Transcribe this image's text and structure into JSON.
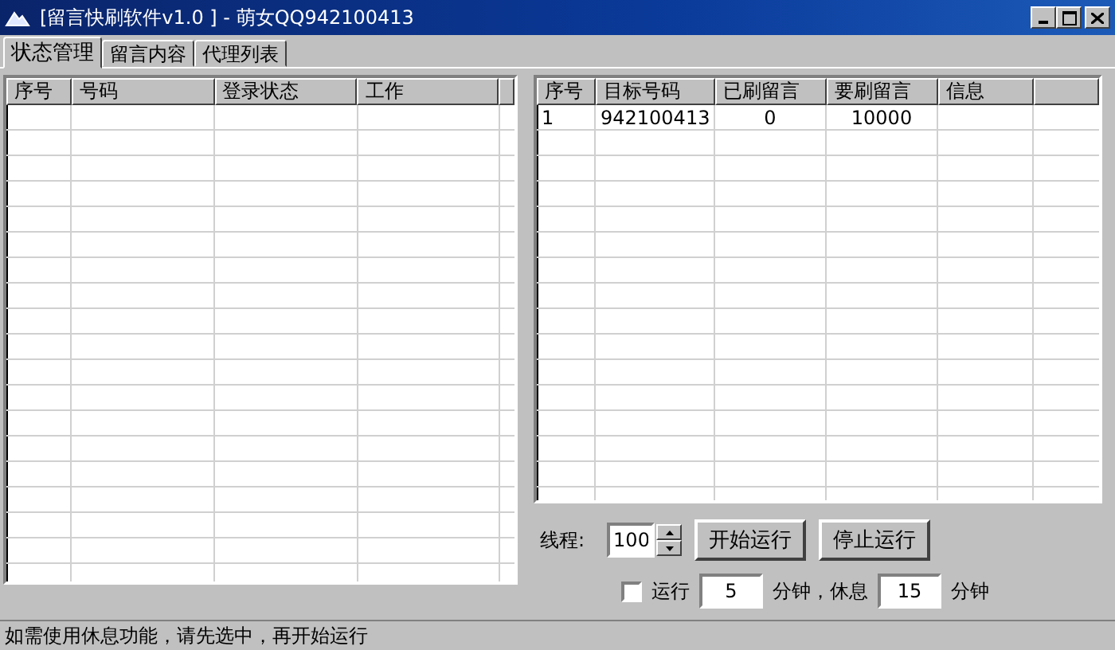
{
  "window": {
    "title": "[留言快刷软件v1.0 ] - 萌女QQ942100413"
  },
  "tabs": [
    {
      "label": "状态管理",
      "selected": true
    },
    {
      "label": "留言内容",
      "selected": false
    },
    {
      "label": "代理列表",
      "selected": false
    }
  ],
  "accounts_table": {
    "columns": [
      "序号",
      "号码",
      "登录状态",
      "工作"
    ]
  },
  "targets_table": {
    "columns": [
      "序号",
      "目标号码",
      "已刷留言",
      "要刷留言",
      "信息"
    ],
    "rows": [
      [
        "1",
        "942100413",
        "0",
        "10000"
      ]
    ]
  },
  "threads": {
    "label": "线程:",
    "value": "100"
  },
  "buttons": [
    "开始运行",
    "停止运行"
  ],
  "rest": {
    "checked": false,
    "label": "运行",
    "run_minutes": "5",
    "unit_run": "分钟，休息",
    "rest_minutes": "15",
    "unit_rest": "分钟"
  },
  "status_bar": "如需使用休息功能，请先选中，再开始运行"
}
